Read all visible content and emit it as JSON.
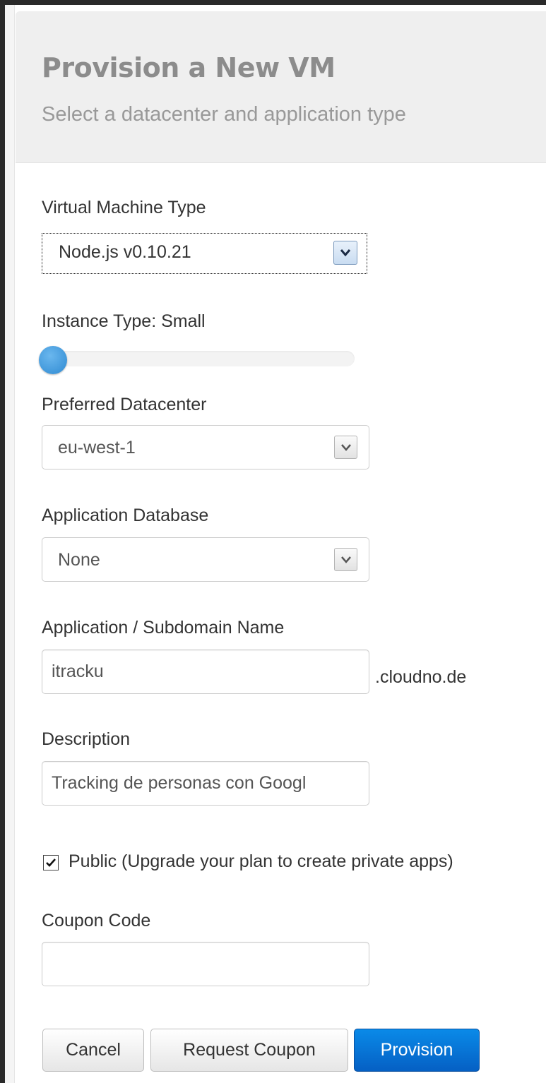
{
  "header": {
    "title": "Provision a New VM",
    "subtitle": "Select a datacenter and application type"
  },
  "vm_type": {
    "label": "Virtual Machine Type",
    "selected": "Node.js v0.10.21"
  },
  "instance_type": {
    "label": "Instance Type: Small",
    "slider_fraction": 0.0
  },
  "datacenter": {
    "label": "Preferred Datacenter",
    "selected": "eu-west-1"
  },
  "database": {
    "label": "Application Database",
    "selected": "None"
  },
  "subdomain": {
    "label": "Application / Subdomain Name",
    "value": "itracku",
    "suffix": ".cloudno.de"
  },
  "description": {
    "label": "Description",
    "value": "Tracking de personas con Googl"
  },
  "public": {
    "checked": true,
    "label": "Public (Upgrade your plan to create private apps)"
  },
  "coupon": {
    "label": "Coupon Code",
    "value": ""
  },
  "actions": {
    "cancel": "Cancel",
    "request_coupon": "Request Coupon",
    "provision": "Provision"
  },
  "colors": {
    "primary": "#0a6fd6",
    "slider_handle": "#3a96dc"
  },
  "icons": {
    "select_arrow": "chevron-down-icon",
    "checkbox": "checkmark-icon"
  }
}
